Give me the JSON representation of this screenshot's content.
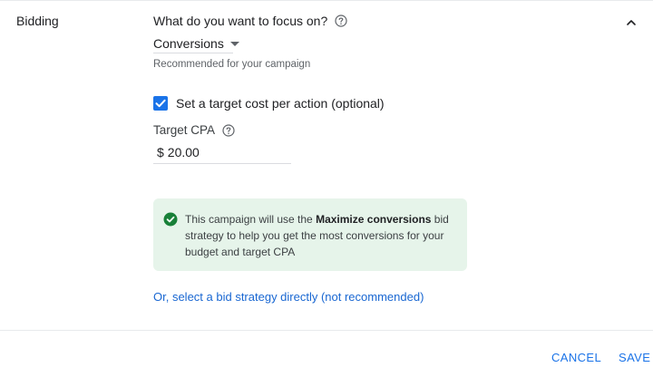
{
  "section": {
    "label": "Bidding"
  },
  "focus": {
    "question": "What do you want to focus on?",
    "selected": "Conversions",
    "note": "Recommended for your campaign"
  },
  "target_cost": {
    "checkbox_label": "Set a target cost per action (optional)",
    "checked": true
  },
  "target_cpa": {
    "label": "Target CPA",
    "currency": "$",
    "value": "20.00"
  },
  "info": {
    "text_before": "This campaign will use the ",
    "text_bold": "Maximize conversions",
    "text_after": " bid strategy to help you get the most conversions for your budget and target CPA"
  },
  "link": {
    "label": "Or, select a bid strategy directly (not recommended)"
  },
  "actions": {
    "cancel": "CANCEL",
    "save": "SAVE"
  },
  "colors": {
    "accent": "#1a73e8",
    "success_bg": "#e6f4ea",
    "success_icon": "#188038"
  },
  "icons": {
    "help": "help-circle-icon",
    "collapse": "chevron-up-icon",
    "check": "checkmark-icon",
    "success": "check-circle-icon"
  }
}
